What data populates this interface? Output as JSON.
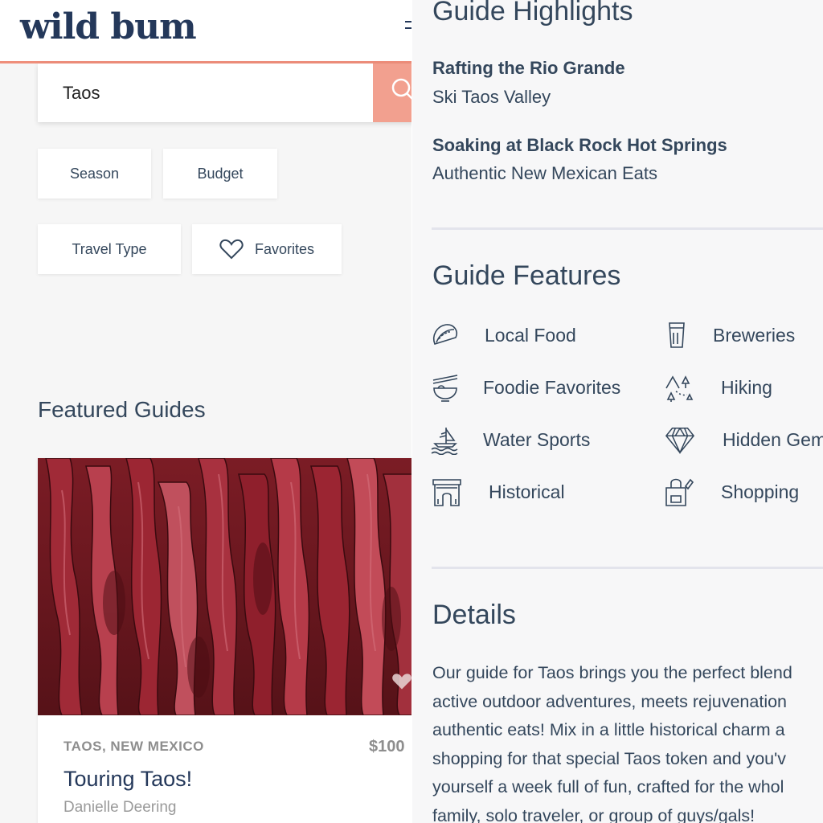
{
  "header": {
    "logo": "wild bum"
  },
  "search": {
    "value": "Taos"
  },
  "filters": {
    "season": "Season",
    "budget": "Budget",
    "travel_type": "Travel Type",
    "favorites": "Favorites"
  },
  "featured": {
    "title": "Featured Guides",
    "card": {
      "location": "TAOS, NEW MEXICO",
      "price": "$100",
      "title": "Touring Taos!",
      "author": "Danielle Deering"
    }
  },
  "highlights": {
    "title": "Guide Highlights",
    "items": [
      {
        "text": "Rafting the Rio Grande",
        "bold": true
      },
      {
        "text": "Ski Taos Valley",
        "bold": false
      },
      {
        "text": "Soaking at Black Rock Hot Springs",
        "bold": true
      },
      {
        "text": "Authentic New Mexican Eats",
        "bold": false
      }
    ]
  },
  "features": {
    "title": "Guide Features",
    "items": [
      {
        "label": "Local Food",
        "icon": "taco-icon"
      },
      {
        "label": "Breweries",
        "icon": "beer-glass-icon"
      },
      {
        "label": "Foodie Favorites",
        "icon": "noodle-bowl-icon"
      },
      {
        "label": "Hiking",
        "icon": "mountain-trail-icon"
      },
      {
        "label": "Water Sports",
        "icon": "sailboat-icon"
      },
      {
        "label": "Hidden Gems",
        "icon": "diamond-icon"
      },
      {
        "label": "Historical",
        "icon": "arch-icon"
      },
      {
        "label": "Shopping",
        "icon": "shopping-bag-icon"
      }
    ]
  },
  "details": {
    "title": "Details",
    "lines": [
      "Our guide for Taos brings you the perfect blend",
      "active outdoor adventures, meets rejuvenation",
      "authentic eats! Mix in a little historical charm a",
      "shopping for that special Taos token and you'v",
      "yourself a week full of fun, crafted for the whol",
      "family, solo traveler, or group of guys/gals!"
    ]
  },
  "colors": {
    "accent": "#ef8f7b",
    "search_button": "#f2a08f",
    "navy": "#24385a",
    "text": "#34475c"
  }
}
